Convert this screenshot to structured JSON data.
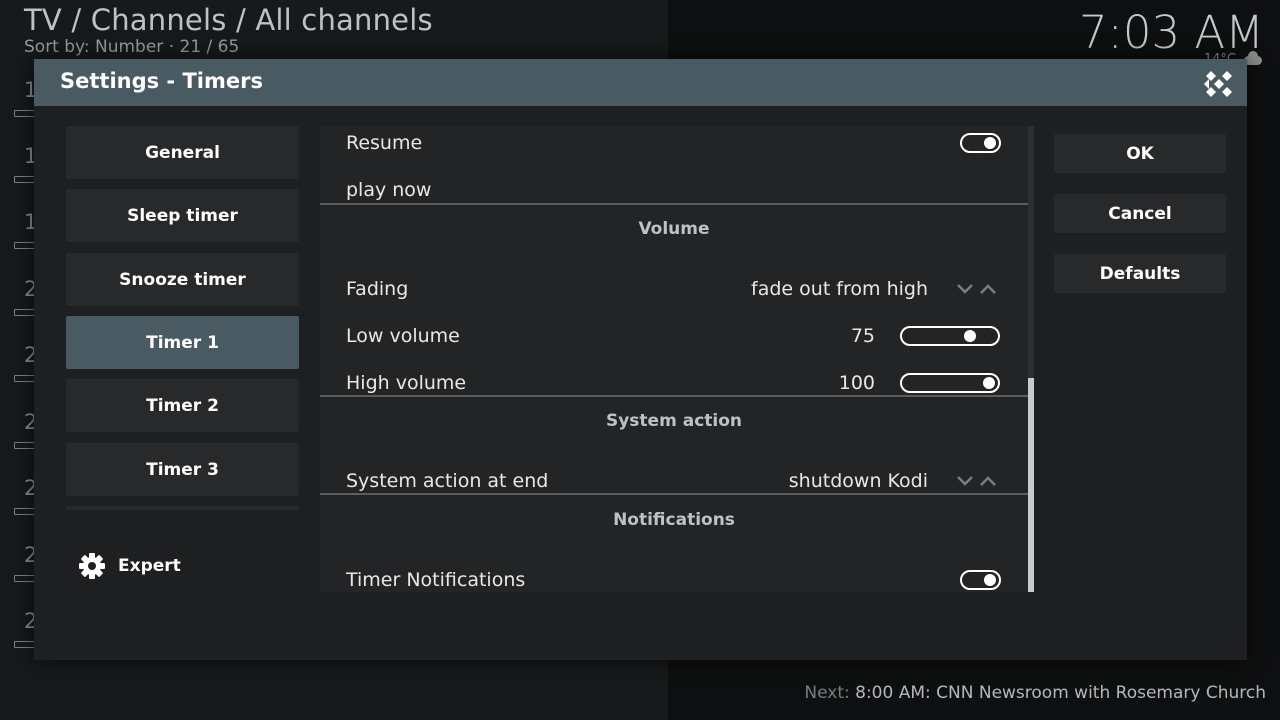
{
  "background": {
    "title": "TV / Channels / All channels",
    "sort": "Sort by: Number  ·  21 / 65",
    "clock": "7:03 AM",
    "temperature": "14°C",
    "next_label": "Next:",
    "next_value": "8:00 AM: CNN Newsroom with Rosemary Church",
    "row_numbers": [
      "1",
      "1",
      "1",
      "2",
      "2",
      "2",
      "2",
      "2",
      "2",
      "2"
    ]
  },
  "dialog": {
    "title": "Settings - Timers",
    "categories": [
      {
        "label": "General",
        "active": false
      },
      {
        "label": "Sleep timer",
        "active": false
      },
      {
        "label": "Snooze timer",
        "active": false
      },
      {
        "label": "Timer 1",
        "active": true
      },
      {
        "label": "Timer 2",
        "active": false
      },
      {
        "label": "Timer 3",
        "active": false
      }
    ],
    "expert_label": "Expert",
    "buttons": {
      "ok": "OK",
      "cancel": "Cancel",
      "defaults": "Defaults"
    },
    "settings": {
      "resume": {
        "label": "Resume",
        "enabled": true
      },
      "play_now": {
        "label": "play now"
      },
      "volume_header": "Volume",
      "fading": {
        "label": "Fading",
        "value": "fade out from high"
      },
      "low_volume": {
        "label": "Low volume",
        "value": "75",
        "level": 0.75
      },
      "high_volume": {
        "label": "High volume",
        "value": "100",
        "level": 1.0
      },
      "system_action_header": "System action",
      "system_action": {
        "label": "System action at end",
        "value": "shutdown Kodi"
      },
      "notifications_header": "Notifications",
      "timer_notifications": {
        "label": "Timer Notifications",
        "enabled": true
      }
    }
  },
  "colors": {
    "accent": "#4a5a63",
    "panel": "#222426",
    "button": "#27292b"
  }
}
